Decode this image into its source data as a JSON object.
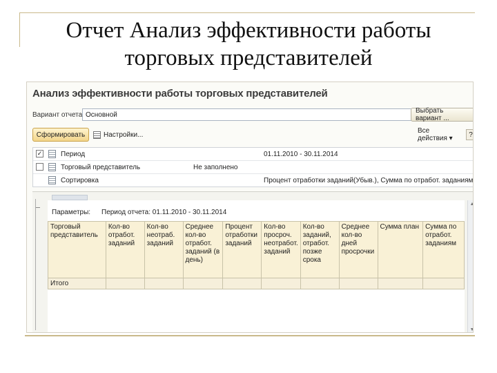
{
  "slide": {
    "title_line1": "Отчет Анализ эффективности работы",
    "title_line2": "торговых представителей"
  },
  "window": {
    "title": "Анализ эффективности работы торговых представителей",
    "variant_label": "Вариант отчета:",
    "variant_value": "Основной",
    "select_variant_button": "Выбрать вариант ...",
    "form_button": "Сформировать",
    "settings_button": "Настройки...",
    "all_actions": "Все действия ▾",
    "help": "?"
  },
  "settings": [
    {
      "checked": true,
      "name": "Период",
      "value": "",
      "value2": "01.11.2010 - 30.11.2014"
    },
    {
      "checked": false,
      "name": "Торговый представитель",
      "value": "Не заполнено",
      "value2": ""
    },
    {
      "checked": null,
      "name": "Сортировка",
      "value": "",
      "value2": "Процент отработки заданий(Убыв.), Сумма по отработ. заданиям(Убыв.),..."
    }
  ],
  "report": {
    "params_label": "Параметры:",
    "params_value": "Период отчета: 01.11.2010 - 30.11.2014",
    "columns": [
      "Торговый представитель",
      "Кол-во отработ. заданий",
      "Кол-во неотраб. заданий",
      "Среднее кол-во отработ. заданий (в день)",
      "Процент отработки заданий",
      "Кол-во просроч. неотработ. заданий",
      "Кол-во заданий, отработ. позже срока",
      "Среднее кол-во дней просрочки",
      "Сумма план",
      "Сумма по отработ. заданиям"
    ],
    "total_label": "Итого"
  }
}
